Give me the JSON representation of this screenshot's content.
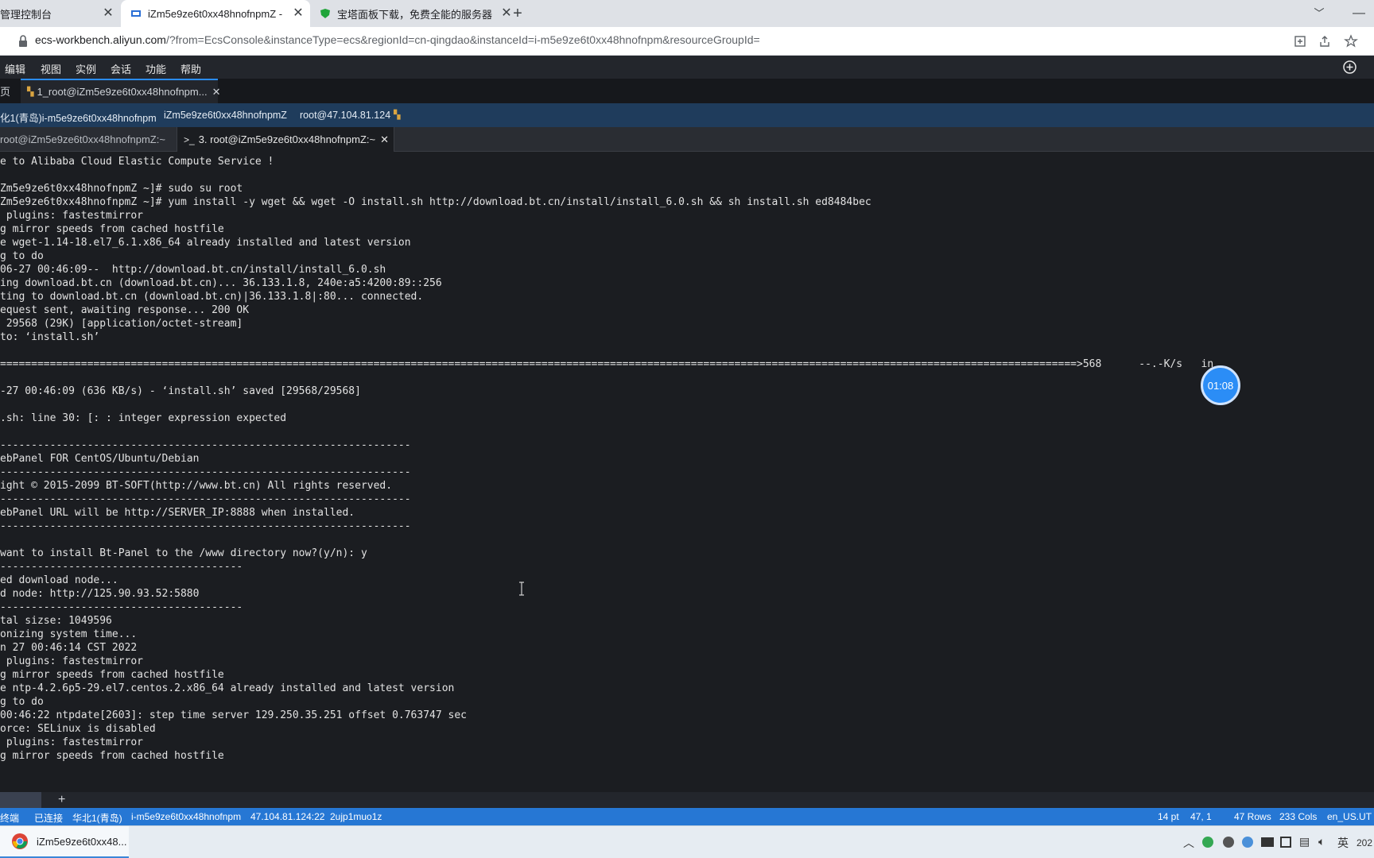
{
  "browser": {
    "tabs": [
      {
        "title": "管理控制台"
      },
      {
        "title": "iZm5e9ze6t0xx48hnofnpmZ - "
      },
      {
        "title": "宝塔面板下载，免费全能的服务器"
      }
    ],
    "new_tab": "+",
    "url_host": "ecs-workbench.aliyun.com",
    "url_rest": "/?from=EcsConsole&instanceType=ecs&regionId=cn-qingdao&instanceId=i-m5e9ze6t0xx48hnofnpm&resourceGroupId="
  },
  "menu": [
    "编辑",
    "视图",
    "实例",
    "会话",
    "功能",
    "帮助"
  ],
  "app_tabs": [
    {
      "label": "页"
    },
    {
      "label": "1_root@iZm5e9ze6t0xx48hnofnpm..."
    }
  ],
  "info": [
    "化1(青岛)i-m5e9ze6t0xx48hnofnpm",
    "iZm5e9ze6t0xx48hnofnpmZ",
    "root@47.104.81.124"
  ],
  "term_tabs": [
    {
      "label": "root@iZm5e9ze6t0xx48hnofnpmZ:~"
    },
    {
      "label": "3. root@iZm5e9ze6t0xx48hnofnpmZ:~"
    }
  ],
  "terminal_lines": [
    "e to Alibaba Cloud Elastic Compute Service !",
    "",
    "Zm5e9ze6t0xx48hnofnpmZ ~]# sudo su root",
    "Zm5e9ze6t0xx48hnofnpmZ ~]# yum install -y wget && wget -O install.sh http://download.bt.cn/install/install_6.0.sh && sh install.sh ed8484bec",
    " plugins: fastestmirror",
    "g mirror speeds from cached hostfile",
    "e wget-1.14-18.el7_6.1.x86_64 already installed and latest version",
    "g to do",
    "06-27 00:46:09--  http://download.bt.cn/install/install_6.0.sh",
    "ing download.bt.cn (download.bt.cn)... 36.133.1.8, 240e:a5:4200:89::256",
    "ting to download.bt.cn (download.bt.cn)|36.133.1.8|:80... connected.",
    "equest sent, awaiting response... 200 OK",
    " 29568 (29K) [application/octet-stream]",
    "to: ‘install.sh’",
    "",
    "=============================================================================================================================================================================>568      --.-K/s   in",
    "",
    "-27 00:46:09 (636 KB/s) - ‘install.sh’ saved [29568/29568]",
    "",
    ".sh: line 30: [: : integer expression expected",
    "",
    "------------------------------------------------------------------",
    "ebPanel FOR CentOS/Ubuntu/Debian",
    "------------------------------------------------------------------",
    "ight © 2015-2099 BT-SOFT(http://www.bt.cn) All rights reserved.",
    "------------------------------------------------------------------",
    "ebPanel URL will be http://SERVER_IP:8888 when installed.",
    "------------------------------------------------------------------",
    "",
    "want to install Bt-Panel to the /www directory now?(y/n): y",
    "---------------------------------------",
    "ed download node...",
    "d node: http://125.90.93.52:5880",
    "---------------------------------------",
    "tal sizse: 1049596",
    "onizing system time...",
    "n 27 00:46:14 CST 2022",
    " plugins: fastestmirror",
    "g mirror speeds from cached hostfile",
    "e ntp-4.2.6p5-29.el7.centos.2.x86_64 already installed and latest version",
    "g to do",
    "00:46:22 ntpdate[2603]: step time server 129.250.35.251 offset 0.763747 sec",
    "orce: SELinux is disabled",
    " plugins: fastestmirror",
    "g mirror speeds from cached hostfile"
  ],
  "timer": "01:08",
  "hscroll_plus": "+",
  "status": {
    "left": "终端",
    "connected": "已连接",
    "region": "华北1(青岛)",
    "instance": "i-m5e9ze6t0xx48hnofnpm",
    "ip": "47.104.81.124:22",
    "session": "2ujp1muo1z",
    "font_size": "14 pt",
    "cursor": "47, 1",
    "rows": "47 Rows",
    "cols": "233 Cols",
    "locale": "en_US.UT"
  },
  "taskbar": {
    "app_title": "iZm5e9ze6t0xx48...",
    "ime": "英",
    "clock": "202"
  },
  "colors": {
    "accent": "#2677d4",
    "terminal_bg": "#1b1d21",
    "timer": "#2b8df6"
  }
}
